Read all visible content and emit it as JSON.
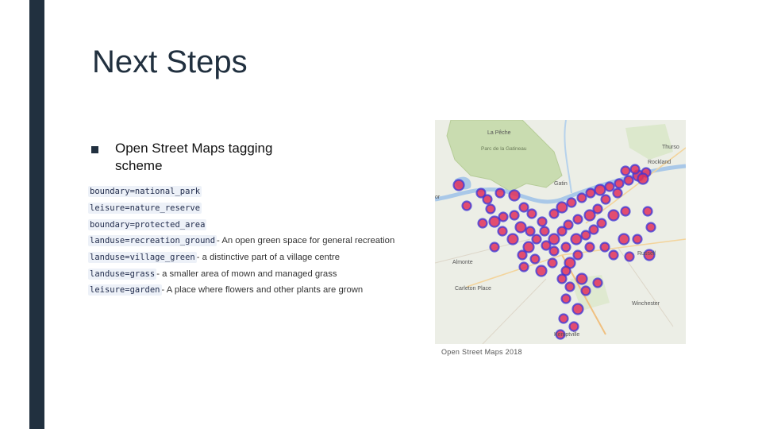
{
  "slide": {
    "title": "Next Steps",
    "bullet": "Open Street Maps tagging scheme"
  },
  "tags": [
    {
      "code": "boundary=national_park",
      "desc": ""
    },
    {
      "code": "leisure=nature_reserve",
      "desc": ""
    },
    {
      "code": "boundary=protected_area",
      "desc": ""
    },
    {
      "code": "landuse=recreation_ground",
      "desc": " - An open green space for general recreation"
    },
    {
      "code": "landuse=village_green",
      "desc": " - a distinctive part of a village centre"
    },
    {
      "code": "landuse=grass",
      "desc": " - a smaller area of mown and managed grass"
    },
    {
      "code": "leisure=garden",
      "desc": " - A place where flowers and other plants are grown"
    }
  ],
  "map": {
    "labels": {
      "lapeche": "La Pêche",
      "park": "Parc de la Gatineau",
      "gatineau": "Gatin",
      "thurso": "Thurso",
      "rockland": "Rockland",
      "almonte": "Almonte",
      "carleton": "Carleton Place",
      "russell": "Russell",
      "winchester": "Winchester",
      "kemptville": "Kemptville",
      "edge": "or"
    },
    "caption": "Open Street Maps 2018"
  },
  "colors": {
    "sidebar": "#21303f",
    "marker_outline": "#3a35d8",
    "marker_fill": "#e0305a",
    "parkland": "#c9dcb0"
  }
}
